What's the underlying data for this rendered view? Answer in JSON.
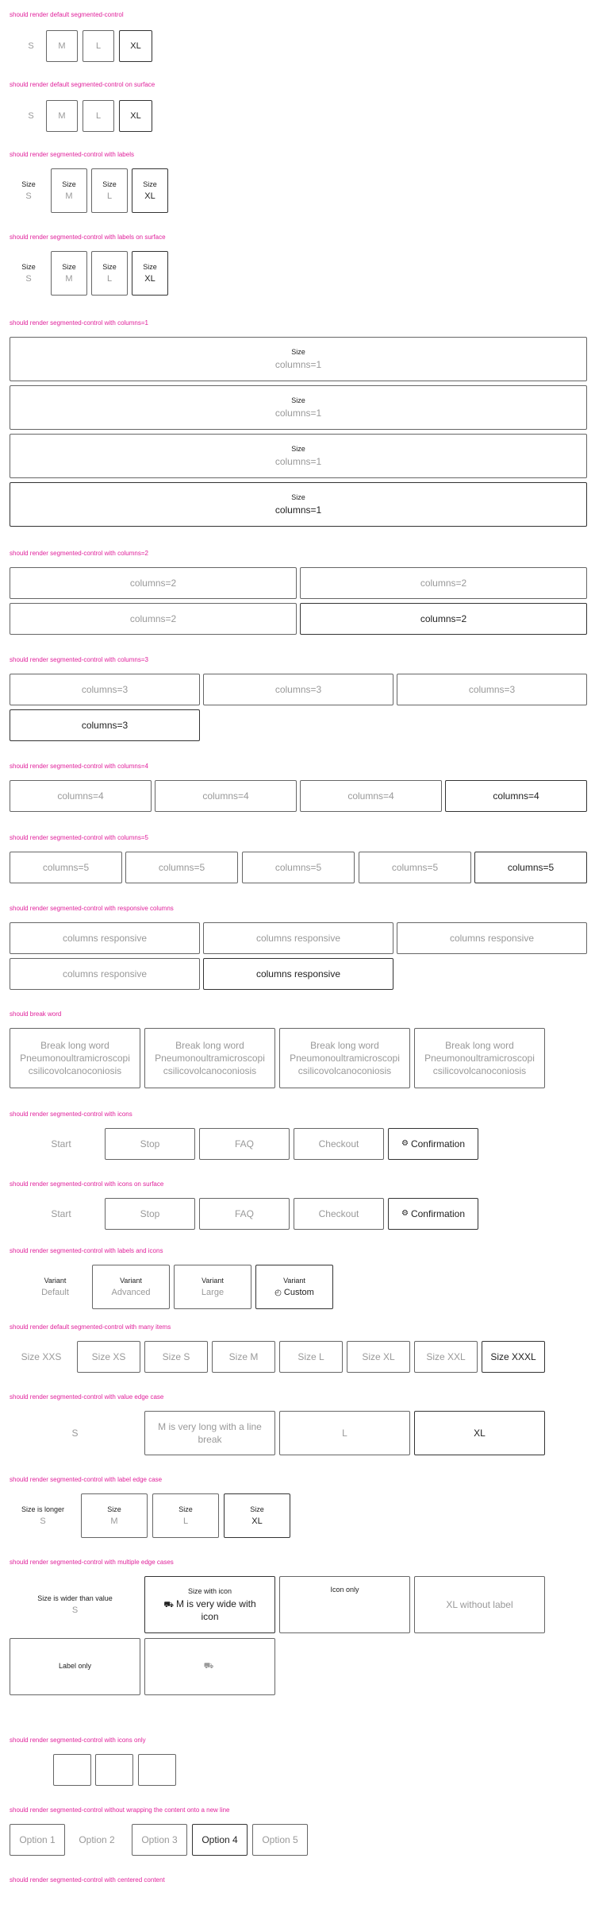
{
  "titles": {
    "t1": "should render default segmented-control",
    "t2": "should render default segmented-control on surface",
    "t3": "should render segmented-control with labels",
    "t4": "should render segmented-control with labels on surface",
    "t5": "should render segmented-control with columns=1",
    "t6": "should render segmented-control with columns=2",
    "t7": "should render segmented-control with columns=3",
    "t8": "should render segmented-control with columns=4",
    "t9": "should render segmented-control with columns=5",
    "t10": "should render segmented-control with responsive columns",
    "t11": "should break word",
    "t12": "should render segmented-control with icons",
    "t13": "should render segmented-control with icons on surface",
    "t14": "should render segmented-control with labels and icons",
    "t15": "should render default segmented-control with many items",
    "t16": "should render segmented-control with value edge case",
    "t17": "should render segmented-control with label edge case",
    "t18": "should render segmented-control with multiple edge cases",
    "t19": "should render segmented-control with icons only",
    "t20": "should render segmented-control without wrapping the content onto a new line",
    "t21": "should render segmented-control with centered content"
  },
  "sizes": {
    "label": "Size",
    "s": "S",
    "m": "M",
    "l": "L",
    "xl": "XL"
  },
  "columns": {
    "c1": "columns=1",
    "c2": "columns=2",
    "c3": "columns=3",
    "c4": "columns=4",
    "c5": "columns=5",
    "responsive": "columns responsive"
  },
  "break_word": {
    "line1": "Break long word",
    "line2": "Pneumonoultramicroscopi",
    "line3": "csilicovolcanoconiosis"
  },
  "icons_row": {
    "start": "Start",
    "stop": "Stop",
    "faq": "FAQ",
    "checkout": "Checkout",
    "confirmation": "Confirmation",
    "confirmation_icon": "gear-icon"
  },
  "variants": {
    "label": "Variant",
    "default": "Default",
    "advanced": "Advanced",
    "large": "Large",
    "custom": "Custom",
    "custom_icon": "gauge-icon"
  },
  "many": [
    "Size XXS",
    "Size XS",
    "Size S",
    "Size M",
    "Size L",
    "Size XL",
    "Size XXL",
    "Size XXXL"
  ],
  "value_edge": {
    "s": "S",
    "m": "M is very long with a line break",
    "l": "L",
    "xl": "XL"
  },
  "label_edge": {
    "label_long": "Size is longer",
    "label": "Size"
  },
  "multi_edge": {
    "label_wider": "Size is wider than value",
    "s": "S",
    "with_icon_label": "Size with icon",
    "m": "M is very wide with icon",
    "icon_only": "Icon only",
    "xl": "XL without label",
    "label_only": "Label only",
    "truck_icon": "truck-icon"
  },
  "options": [
    "Option 1",
    "Option 2",
    "Option 3",
    "Option 4",
    "Option 5"
  ]
}
